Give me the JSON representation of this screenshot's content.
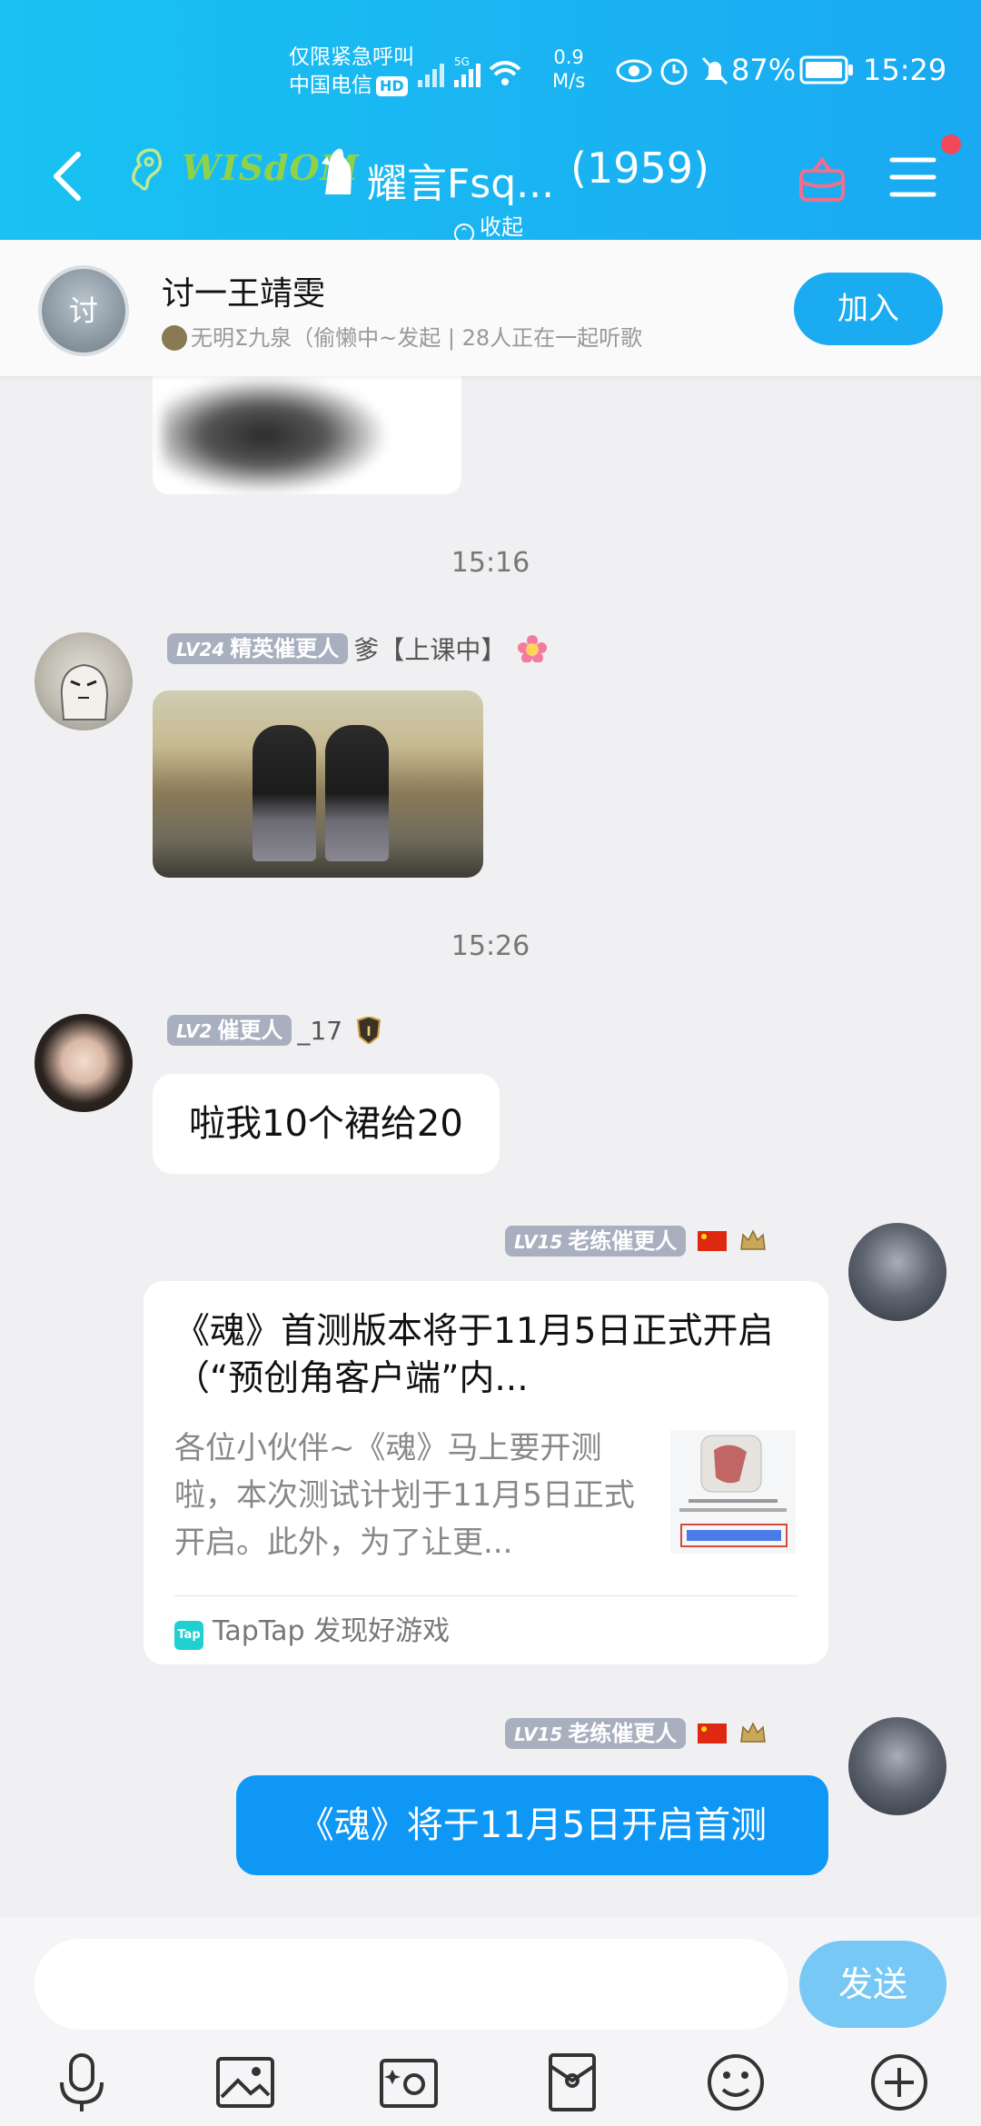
{
  "status_bar": {
    "emergency": "仅限紧急呼叫",
    "carrier": "中国电信",
    "hd": "HD",
    "speed_value": "0.9",
    "speed_unit": "M/s",
    "battery": "87%",
    "time": "15:29"
  },
  "header": {
    "wisdom_badge": "WISdOM",
    "group_title": "耀言Fsq...",
    "member_count": "(1959)",
    "collapse_label": "收起"
  },
  "listen_together": {
    "avatar_text": "讨",
    "title": "讨一王靖雯",
    "subtitle": "无明Σ九泉（偷懒中~发起 | 28人正在一起听歌",
    "join_label": "加入"
  },
  "messages": [
    {
      "type": "timestamp",
      "text": "15:16"
    },
    {
      "type": "incoming",
      "level": "LV24",
      "title": "精英催更人",
      "sender": "爹【上课中】",
      "content_kind": "video"
    },
    {
      "type": "timestamp",
      "text": "15:26"
    },
    {
      "type": "incoming",
      "level": "LV2",
      "title": "催更人",
      "sender": "_17",
      "text": "啦我10个裙给20"
    },
    {
      "type": "outgoing",
      "level": "LV15",
      "title": "老练催更人",
      "card": {
        "title": "《魂》首测版本将于11月5日正式开启（“预创角客户端”内...",
        "desc": "各位小伙伴~《魂》马上要开测啦，本次测试计划于11月5日正式开启。此外，为了让更...",
        "source_logo": "Tap",
        "source": "TapTap 发现好游戏"
      }
    },
    {
      "type": "outgoing",
      "level": "LV15",
      "title": "老练催更人",
      "text": "《魂》将于11月5日开启首测"
    }
  ],
  "input": {
    "placeholder": "",
    "send_label": "发送"
  },
  "toolbar": [
    "microphone-icon",
    "image-icon",
    "camera-icon",
    "red-packet-icon",
    "emoji-icon",
    "plus-icon"
  ],
  "colors": {
    "header": "#19c2f2",
    "accent_blue": "#0f97f5",
    "level_badge": "#a8afbf",
    "send_button": "#78c8f5"
  }
}
